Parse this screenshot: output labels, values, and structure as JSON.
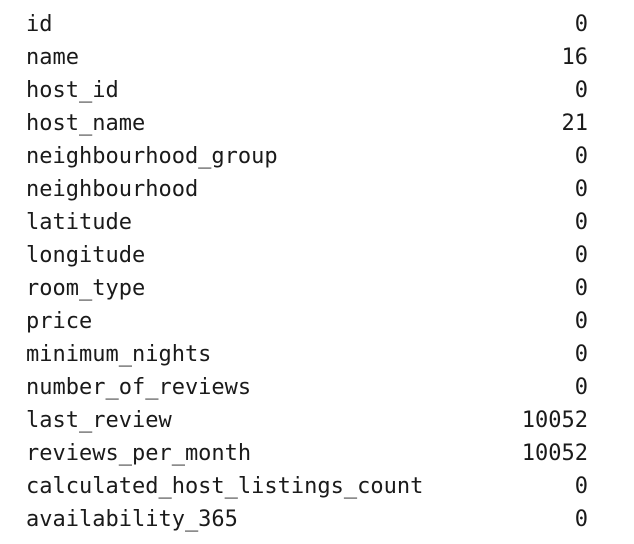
{
  "rows": [
    {
      "label": "id",
      "value": "0"
    },
    {
      "label": "name",
      "value": "16"
    },
    {
      "label": "host_id",
      "value": "0"
    },
    {
      "label": "host_name",
      "value": "21"
    },
    {
      "label": "neighbourhood_group",
      "value": "0"
    },
    {
      "label": "neighbourhood",
      "value": "0"
    },
    {
      "label": "latitude",
      "value": "0"
    },
    {
      "label": "longitude",
      "value": "0"
    },
    {
      "label": "room_type",
      "value": "0"
    },
    {
      "label": "price",
      "value": "0"
    },
    {
      "label": "minimum_nights",
      "value": "0"
    },
    {
      "label": "number_of_reviews",
      "value": "0"
    },
    {
      "label": "last_review",
      "value": "10052"
    },
    {
      "label": "reviews_per_month",
      "value": "10052"
    },
    {
      "label": "calculated_host_listings_count",
      "value": "0"
    },
    {
      "label": "availability_365",
      "value": "0"
    }
  ]
}
